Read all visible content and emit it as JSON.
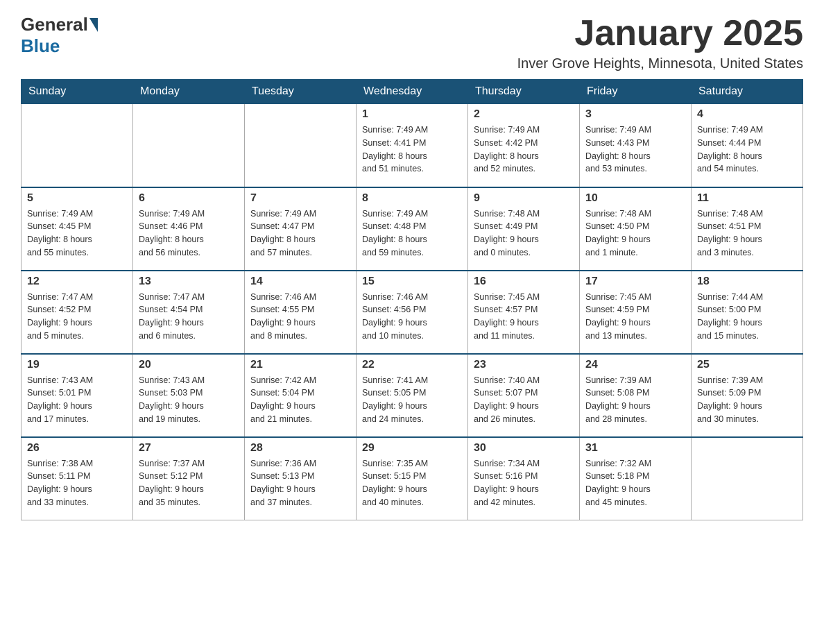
{
  "header": {
    "logo_general": "General",
    "logo_blue": "Blue",
    "month_title": "January 2025",
    "location": "Inver Grove Heights, Minnesota, United States"
  },
  "weekdays": [
    "Sunday",
    "Monday",
    "Tuesday",
    "Wednesday",
    "Thursday",
    "Friday",
    "Saturday"
  ],
  "weeks": [
    [
      {
        "day": "",
        "info": ""
      },
      {
        "day": "",
        "info": ""
      },
      {
        "day": "",
        "info": ""
      },
      {
        "day": "1",
        "info": "Sunrise: 7:49 AM\nSunset: 4:41 PM\nDaylight: 8 hours\nand 51 minutes."
      },
      {
        "day": "2",
        "info": "Sunrise: 7:49 AM\nSunset: 4:42 PM\nDaylight: 8 hours\nand 52 minutes."
      },
      {
        "day": "3",
        "info": "Sunrise: 7:49 AM\nSunset: 4:43 PM\nDaylight: 8 hours\nand 53 minutes."
      },
      {
        "day": "4",
        "info": "Sunrise: 7:49 AM\nSunset: 4:44 PM\nDaylight: 8 hours\nand 54 minutes."
      }
    ],
    [
      {
        "day": "5",
        "info": "Sunrise: 7:49 AM\nSunset: 4:45 PM\nDaylight: 8 hours\nand 55 minutes."
      },
      {
        "day": "6",
        "info": "Sunrise: 7:49 AM\nSunset: 4:46 PM\nDaylight: 8 hours\nand 56 minutes."
      },
      {
        "day": "7",
        "info": "Sunrise: 7:49 AM\nSunset: 4:47 PM\nDaylight: 8 hours\nand 57 minutes."
      },
      {
        "day": "8",
        "info": "Sunrise: 7:49 AM\nSunset: 4:48 PM\nDaylight: 8 hours\nand 59 minutes."
      },
      {
        "day": "9",
        "info": "Sunrise: 7:48 AM\nSunset: 4:49 PM\nDaylight: 9 hours\nand 0 minutes."
      },
      {
        "day": "10",
        "info": "Sunrise: 7:48 AM\nSunset: 4:50 PM\nDaylight: 9 hours\nand 1 minute."
      },
      {
        "day": "11",
        "info": "Sunrise: 7:48 AM\nSunset: 4:51 PM\nDaylight: 9 hours\nand 3 minutes."
      }
    ],
    [
      {
        "day": "12",
        "info": "Sunrise: 7:47 AM\nSunset: 4:52 PM\nDaylight: 9 hours\nand 5 minutes."
      },
      {
        "day": "13",
        "info": "Sunrise: 7:47 AM\nSunset: 4:54 PM\nDaylight: 9 hours\nand 6 minutes."
      },
      {
        "day": "14",
        "info": "Sunrise: 7:46 AM\nSunset: 4:55 PM\nDaylight: 9 hours\nand 8 minutes."
      },
      {
        "day": "15",
        "info": "Sunrise: 7:46 AM\nSunset: 4:56 PM\nDaylight: 9 hours\nand 10 minutes."
      },
      {
        "day": "16",
        "info": "Sunrise: 7:45 AM\nSunset: 4:57 PM\nDaylight: 9 hours\nand 11 minutes."
      },
      {
        "day": "17",
        "info": "Sunrise: 7:45 AM\nSunset: 4:59 PM\nDaylight: 9 hours\nand 13 minutes."
      },
      {
        "day": "18",
        "info": "Sunrise: 7:44 AM\nSunset: 5:00 PM\nDaylight: 9 hours\nand 15 minutes."
      }
    ],
    [
      {
        "day": "19",
        "info": "Sunrise: 7:43 AM\nSunset: 5:01 PM\nDaylight: 9 hours\nand 17 minutes."
      },
      {
        "day": "20",
        "info": "Sunrise: 7:43 AM\nSunset: 5:03 PM\nDaylight: 9 hours\nand 19 minutes."
      },
      {
        "day": "21",
        "info": "Sunrise: 7:42 AM\nSunset: 5:04 PM\nDaylight: 9 hours\nand 21 minutes."
      },
      {
        "day": "22",
        "info": "Sunrise: 7:41 AM\nSunset: 5:05 PM\nDaylight: 9 hours\nand 24 minutes."
      },
      {
        "day": "23",
        "info": "Sunrise: 7:40 AM\nSunset: 5:07 PM\nDaylight: 9 hours\nand 26 minutes."
      },
      {
        "day": "24",
        "info": "Sunrise: 7:39 AM\nSunset: 5:08 PM\nDaylight: 9 hours\nand 28 minutes."
      },
      {
        "day": "25",
        "info": "Sunrise: 7:39 AM\nSunset: 5:09 PM\nDaylight: 9 hours\nand 30 minutes."
      }
    ],
    [
      {
        "day": "26",
        "info": "Sunrise: 7:38 AM\nSunset: 5:11 PM\nDaylight: 9 hours\nand 33 minutes."
      },
      {
        "day": "27",
        "info": "Sunrise: 7:37 AM\nSunset: 5:12 PM\nDaylight: 9 hours\nand 35 minutes."
      },
      {
        "day": "28",
        "info": "Sunrise: 7:36 AM\nSunset: 5:13 PM\nDaylight: 9 hours\nand 37 minutes."
      },
      {
        "day": "29",
        "info": "Sunrise: 7:35 AM\nSunset: 5:15 PM\nDaylight: 9 hours\nand 40 minutes."
      },
      {
        "day": "30",
        "info": "Sunrise: 7:34 AM\nSunset: 5:16 PM\nDaylight: 9 hours\nand 42 minutes."
      },
      {
        "day": "31",
        "info": "Sunrise: 7:32 AM\nSunset: 5:18 PM\nDaylight: 9 hours\nand 45 minutes."
      },
      {
        "day": "",
        "info": ""
      }
    ]
  ]
}
